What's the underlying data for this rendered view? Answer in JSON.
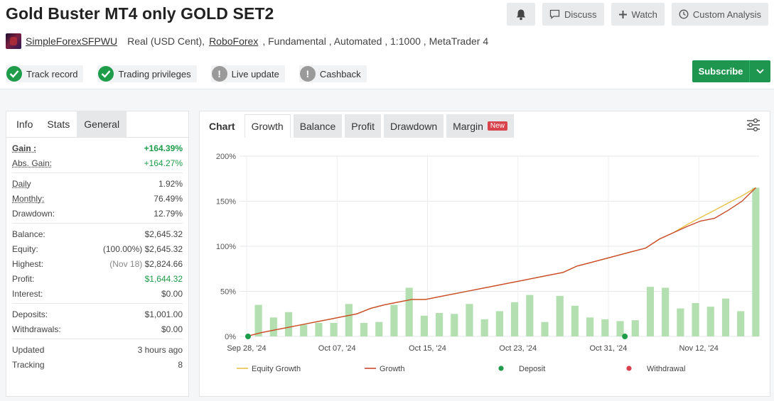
{
  "header": {
    "title": "Gold Buster MT4 only GOLD SET2",
    "actions": {
      "discuss": "Discuss",
      "watch": "Watch",
      "custom": "Custom Analysis"
    },
    "username": "SimpleForexSFPWU",
    "account_type": "Real (USD Cent),",
    "broker": "RoboForex",
    "details": ", Fundamental , Automated , 1:1000 , MetaTrader 4",
    "badges": [
      {
        "label": "Track record",
        "status": "ok"
      },
      {
        "label": "Trading privileges",
        "status": "ok"
      },
      {
        "label": "Live update",
        "status": "warn"
      },
      {
        "label": "Cashback",
        "status": "warn"
      }
    ],
    "subscribe": "Subscribe"
  },
  "left": {
    "tabs": [
      "Info",
      "Stats",
      "General"
    ],
    "gain": {
      "label": "Gain :",
      "value": "+164.39%"
    },
    "abs_gain": {
      "label": "Abs. Gain:",
      "value": "+164.27%"
    },
    "daily": {
      "label": "Daily",
      "value": "1.92%"
    },
    "monthly": {
      "label": "Monthly:",
      "value": "76.49%"
    },
    "drawdown": {
      "label": "Drawdown:",
      "value": "12.79%"
    },
    "balance": {
      "label": "Balance:",
      "value": "$2,645.32"
    },
    "equity": {
      "label": "Equity:",
      "pct": "(100.00%)",
      "value": "$2,645.32"
    },
    "highest": {
      "label": "Highest:",
      "date": "(Nov 18)",
      "value": "$2,824.66"
    },
    "profit": {
      "label": "Profit:",
      "value": "$1,644.32"
    },
    "interest": {
      "label": "Interest:",
      "value": "$0.00"
    },
    "deposits": {
      "label": "Deposits:",
      "value": "$1,001.00"
    },
    "withdrawals": {
      "label": "Withdrawals:",
      "value": "$0.00"
    },
    "updated": {
      "label": "Updated",
      "value": "3 hours ago"
    },
    "tracking": {
      "label": "Tracking",
      "value": "8"
    }
  },
  "right": {
    "tabs": [
      "Chart",
      "Growth",
      "Balance",
      "Profit",
      "Drawdown",
      "Margin"
    ],
    "new_label": "New"
  },
  "colors": {
    "accent_green": "#1e9c4a",
    "bar_green": "#b4dfb0",
    "growth_line": "#c94a2c",
    "equity_line": "#e8c347",
    "withdrawal": "#d9434e"
  },
  "chart_data": {
    "type": "bar",
    "y_tick_labels": [
      "0%",
      "50%",
      "100%",
      "150%",
      "200%"
    ],
    "ylim": [
      0,
      200
    ],
    "x_tick_labels": [
      "Sep 28, '24",
      "Oct 07, '24",
      "Oct 15, '24",
      "Oct 23, '24",
      "Oct 31, '24",
      "Nov 12, '24"
    ],
    "bar_values": [
      35,
      21,
      27,
      13,
      15,
      15,
      36,
      15,
      16,
      35,
      54,
      23,
      26,
      25,
      36,
      19,
      28,
      38,
      46,
      16,
      45,
      34,
      21,
      19,
      17,
      18,
      55,
      54,
      31,
      37,
      33,
      42,
      28,
      165
    ],
    "growth": [
      0,
      4,
      7,
      10,
      13,
      16,
      19,
      22,
      25,
      31,
      35,
      38,
      41,
      41,
      44,
      47,
      50,
      53,
      56,
      59,
      62,
      65,
      68,
      71,
      78,
      82,
      86,
      90,
      94,
      98,
      108,
      115,
      122,
      128,
      131,
      140,
      150,
      165
    ],
    "equity_growth": [
      0,
      4,
      7,
      10,
      13,
      16,
      19,
      22,
      25,
      31,
      35,
      38,
      41,
      41,
      44,
      47,
      50,
      53,
      56,
      59,
      62,
      65,
      68,
      71,
      78,
      82,
      86,
      90,
      94,
      98,
      108,
      115,
      124,
      132,
      140,
      148,
      156,
      165
    ],
    "deposits_at": [
      0,
      25
    ],
    "legend": [
      "Equity Growth",
      "Growth",
      "Deposit",
      "Withdrawal"
    ]
  }
}
